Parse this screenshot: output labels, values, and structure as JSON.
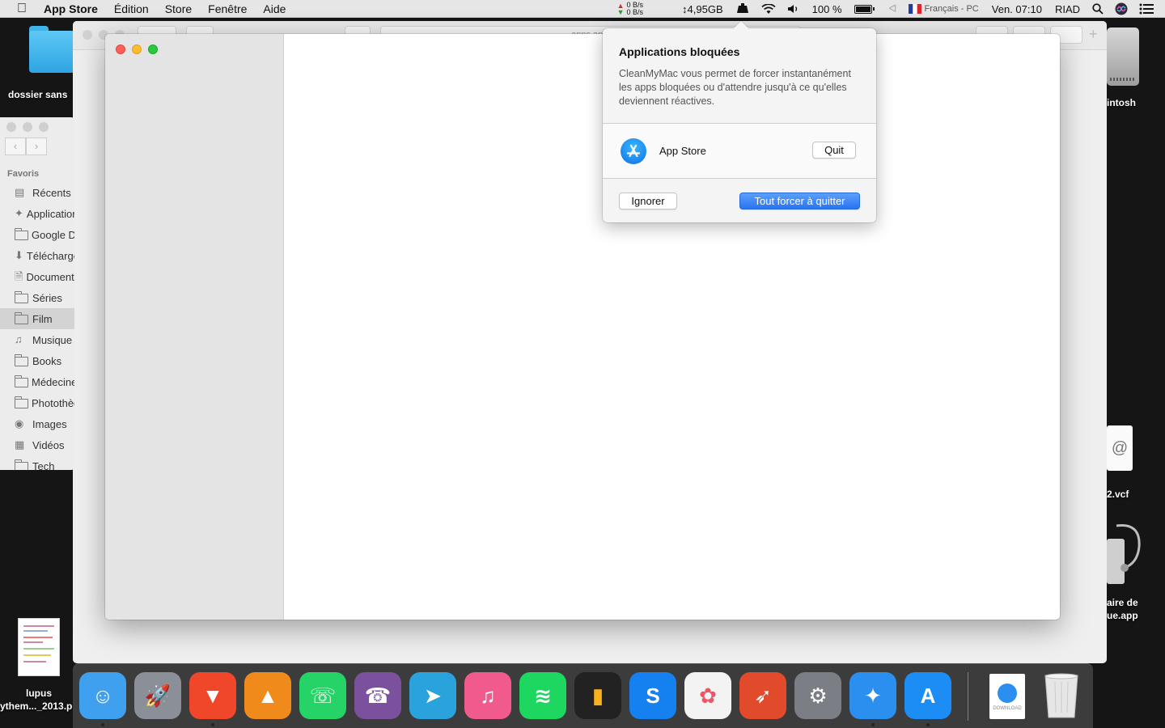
{
  "menubar": {
    "active_app": "App Store",
    "menus": [
      "Édition",
      "Store",
      "Fenêtre",
      "Aide"
    ],
    "net_up": "0 B/s",
    "net_down": "0 B/s",
    "memory": "↕4,95GB",
    "battery": "100 %",
    "battery_level": 1.0,
    "input_source": "Français - PC",
    "clock": "Ven. 07:10",
    "user": "RIAD"
  },
  "desktop": {
    "folder_label": "dossier sans",
    "hdd_label": "intosh",
    "vcf_label": "2.vcf",
    "app_label_1": "aire de",
    "app_label_2": "ue.app",
    "pdf_label_1": "lupus",
    "pdf_label_2": "ythem..._2013.p"
  },
  "back_window": {
    "address_fragment": "apps.appl"
  },
  "finder": {
    "section_title": "Favoris",
    "items": [
      {
        "label": "Récents",
        "icon": "recents-icon"
      },
      {
        "label": "Applications",
        "icon": "applications-icon"
      },
      {
        "label": "Google Drive",
        "icon": "folder-icon"
      },
      {
        "label": "Téléchargements",
        "icon": "downloads-icon"
      },
      {
        "label": "Documents",
        "icon": "document-icon"
      },
      {
        "label": "Séries",
        "icon": "folder-icon"
      },
      {
        "label": "Film",
        "icon": "folder-icon"
      },
      {
        "label": "Musique",
        "icon": "music-icon"
      },
      {
        "label": "Books",
        "icon": "folder-icon"
      },
      {
        "label": "Médecine",
        "icon": "folder-icon"
      },
      {
        "label": "Photothèque",
        "icon": "folder-icon"
      },
      {
        "label": "Images",
        "icon": "camera-icon"
      },
      {
        "label": "Vidéos",
        "icon": "film-icon"
      },
      {
        "label": "Tech",
        "icon": "folder-icon"
      }
    ],
    "selected": "Film"
  },
  "popover": {
    "title": "Applications bloquées",
    "description": "CleanMyMac vous permet de forcer instantanément les apps bloquées ou d'attendre jusqu'à ce qu'elles deviennent réactives.",
    "app_name": "App Store",
    "quit_label": "Quit",
    "ignore_label": "Ignorer",
    "force_quit_all_label": "Tout forcer à quitter"
  },
  "dock": {
    "apps": [
      {
        "name": "Finder",
        "icon": "finder-icon",
        "color": "#3fa0f0",
        "running": true
      },
      {
        "name": "Launchpad",
        "icon": "rocket-icon",
        "color": "#8a8f98",
        "running": false
      },
      {
        "name": "Brave",
        "icon": "brave-lion-icon",
        "color": "#f0472a",
        "running": true
      },
      {
        "name": "VLC",
        "icon": "vlc-cone-icon",
        "color": "#f08a1a",
        "running": false
      },
      {
        "name": "WhatsApp",
        "icon": "whatsapp-icon",
        "color": "#25d366",
        "running": false
      },
      {
        "name": "Viber",
        "icon": "viber-icon",
        "color": "#7b519d",
        "running": false
      },
      {
        "name": "Telegram",
        "icon": "telegram-icon",
        "color": "#2aa3dc",
        "running": false
      },
      {
        "name": "iTunes",
        "icon": "music-note-icon",
        "color": "#f15a8c",
        "running": false
      },
      {
        "name": "Spotify",
        "icon": "spotify-icon",
        "color": "#1ed760",
        "running": false
      },
      {
        "name": "Deezer",
        "icon": "deezer-icon",
        "color": "#222222",
        "running": false
      },
      {
        "name": "Shazam",
        "icon": "shazam-icon",
        "color": "#1581f0",
        "running": false
      },
      {
        "name": "Photos",
        "icon": "photos-icon",
        "color": "#f3f3f3",
        "running": false
      },
      {
        "name": "CleanMyMac",
        "icon": "rocket-app-icon",
        "color": "#e24a2c",
        "running": false
      },
      {
        "name": "Préférences Système",
        "icon": "gear-icon",
        "color": "#7b7f85",
        "running": false
      },
      {
        "name": "Safari",
        "icon": "safari-compass-icon",
        "color": "#2b8ff0",
        "running": true
      },
      {
        "name": "App Store",
        "icon": "app-store-icon",
        "color": "#1c8df5",
        "running": true
      }
    ],
    "download_stack_label": "DOWNLOAD",
    "trash_label": "Corbeille"
  }
}
